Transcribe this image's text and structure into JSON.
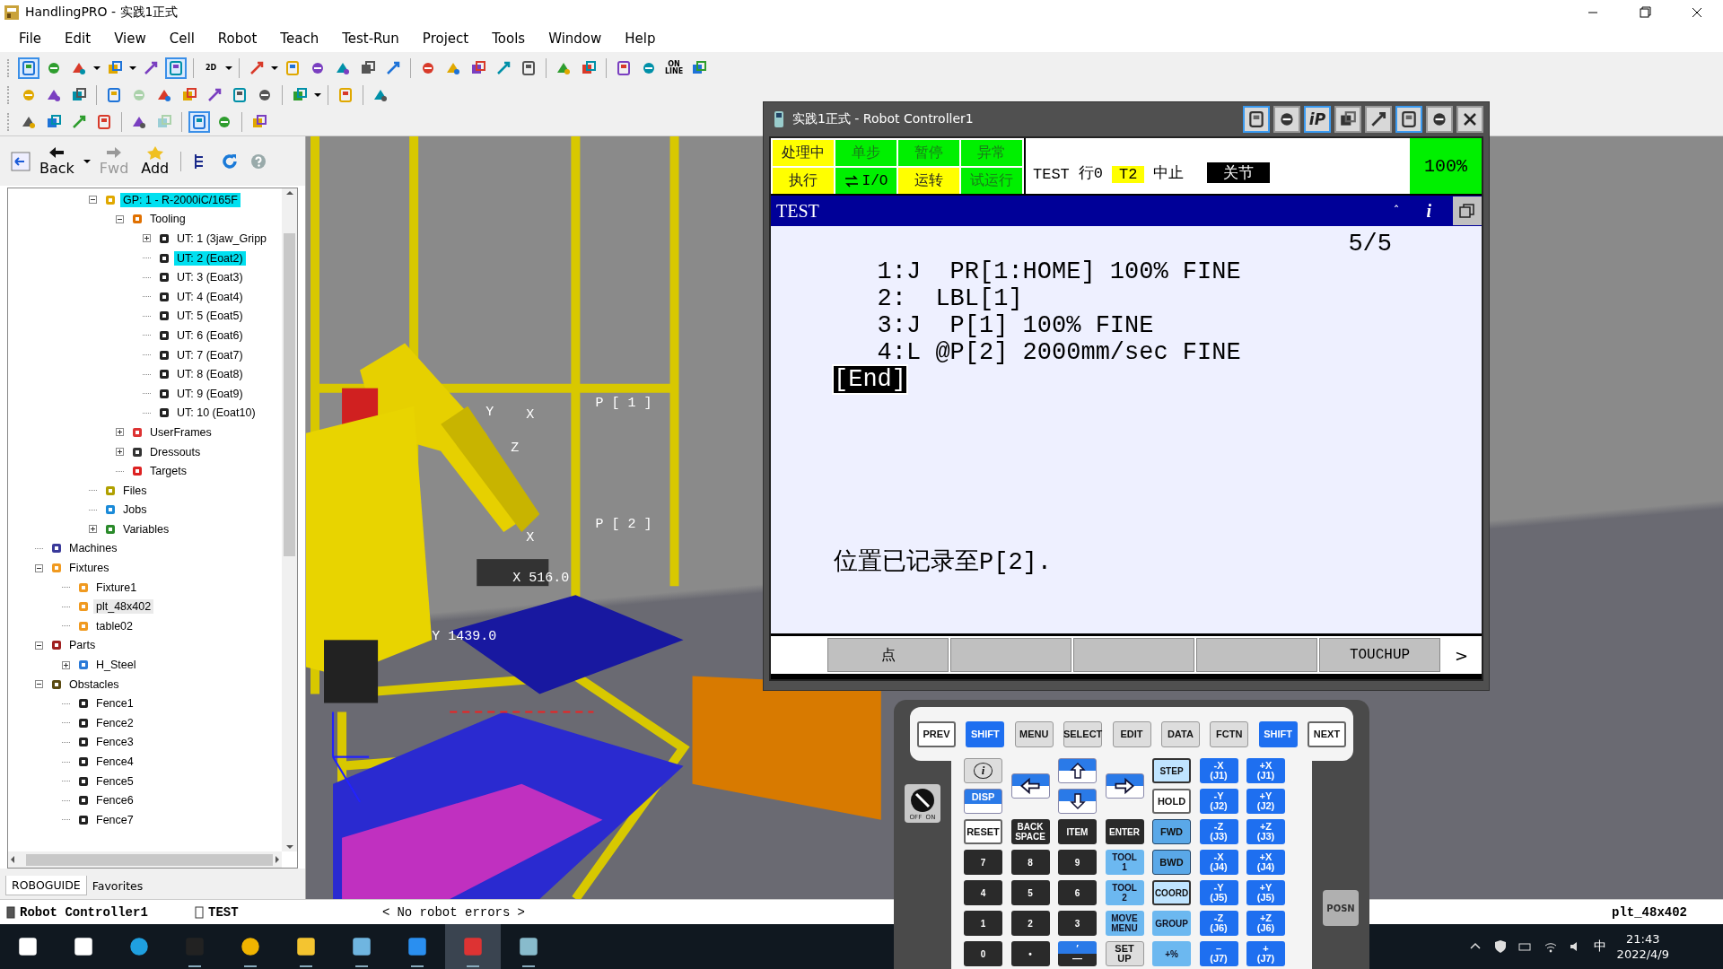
{
  "window": {
    "title": "HandlingPRO - 实践1正式"
  },
  "menu": [
    "File",
    "Edit",
    "View",
    "Cell",
    "Robot",
    "Teach",
    "Test-Run",
    "Project",
    "Tools",
    "Window",
    "Help"
  ],
  "toolbars": [
    [
      {
        "kind": "tool",
        "selected": true
      },
      {
        "kind": "tool",
        "selected": false
      },
      {
        "kind": "tool",
        "selected": false,
        "dropdown": true
      },
      {
        "kind": "tool",
        "selected": false,
        "dropdown": true
      },
      {
        "kind": "tool",
        "selected": false
      },
      {
        "kind": "tool",
        "selected": true
      },
      {
        "kind": "separator"
      },
      {
        "kind": "tool",
        "selected": false,
        "dropdown": true,
        "label": "2D"
      },
      {
        "kind": "separator"
      },
      {
        "kind": "tool",
        "selected": false,
        "dropdown": true
      },
      {
        "kind": "tool",
        "selected": false
      },
      {
        "kind": "tool",
        "selected": false
      },
      {
        "kind": "tool",
        "selected": false
      },
      {
        "kind": "tool",
        "selected": false
      },
      {
        "kind": "tool",
        "selected": false
      },
      {
        "kind": "separator"
      },
      {
        "kind": "tool",
        "selected": false
      },
      {
        "kind": "tool",
        "selected": false
      },
      {
        "kind": "tool",
        "selected": false
      },
      {
        "kind": "tool",
        "selected": false
      },
      {
        "kind": "tool",
        "selected": false
      },
      {
        "kind": "separator"
      },
      {
        "kind": "tool",
        "selected": false
      },
      {
        "kind": "tool",
        "selected": false
      },
      {
        "kind": "separator"
      },
      {
        "kind": "tool",
        "selected": false
      },
      {
        "kind": "tool",
        "selected": false
      },
      {
        "kind": "tool",
        "selected": false,
        "label": "ON\nLINE"
      },
      {
        "kind": "tool",
        "selected": false
      }
    ],
    [
      {
        "kind": "tool",
        "selected": false
      },
      {
        "kind": "tool",
        "selected": false
      },
      {
        "kind": "tool",
        "selected": false
      },
      {
        "kind": "separator"
      },
      {
        "kind": "tool",
        "selected": false
      },
      {
        "kind": "tool",
        "selected": false,
        "disabled": true
      },
      {
        "kind": "tool",
        "selected": false
      },
      {
        "kind": "tool",
        "selected": false
      },
      {
        "kind": "tool",
        "selected": false
      },
      {
        "kind": "tool",
        "selected": false
      },
      {
        "kind": "tool",
        "selected": false
      },
      {
        "kind": "separator"
      },
      {
        "kind": "tool",
        "selected": false,
        "dropdown": true
      },
      {
        "kind": "separator"
      },
      {
        "kind": "tool",
        "selected": false
      },
      {
        "kind": "separator"
      },
      {
        "kind": "tool",
        "selected": false
      }
    ],
    [
      {
        "kind": "tool",
        "selected": false
      },
      {
        "kind": "tool",
        "selected": false
      },
      {
        "kind": "tool",
        "selected": false
      },
      {
        "kind": "tool",
        "selected": false
      },
      {
        "kind": "separator"
      },
      {
        "kind": "tool",
        "selected": false
      },
      {
        "kind": "tool",
        "selected": false,
        "disabled": true
      },
      {
        "kind": "separator"
      },
      {
        "kind": "tool",
        "selected": true
      },
      {
        "kind": "tool",
        "selected": false
      },
      {
        "kind": "separator"
      },
      {
        "kind": "tool",
        "selected": false
      }
    ]
  ],
  "nav": [
    {
      "label": "Back",
      "dropdown": true,
      "disabled": false
    },
    {
      "label": "Fwd",
      "disabled": true
    },
    {
      "label": "Add",
      "disabled": false
    }
  ],
  "tree": {
    "branch": [
      {
        "label": "GP: 1 - R-2000iC/165F",
        "kind": "robot",
        "selected": true,
        "expanded": true,
        "children": [
          {
            "label": "Tooling",
            "kind": "tooling",
            "selected": false,
            "expanded": true,
            "children": [
              {
                "label": "UT: 1  (3jaw_Gripp",
                "kind": "tool",
                "selected": false,
                "expanded": false
              },
              {
                "label": "UT: 2  (Eoat2)",
                "kind": "tool",
                "selected": true
              },
              {
                "label": "UT: 3  (Eoat3)",
                "kind": "tool",
                "selected": false
              },
              {
                "label": "UT: 4  (Eoat4)",
                "kind": "tool",
                "selected": false
              },
              {
                "label": "UT: 5  (Eoat5)",
                "kind": "tool",
                "selected": false
              },
              {
                "label": "UT: 6  (Eoat6)",
                "kind": "tool",
                "selected": false
              },
              {
                "label": "UT: 7  (Eoat7)",
                "kind": "tool",
                "selected": false
              },
              {
                "label": "UT: 8  (Eoat8)",
                "kind": "tool",
                "selected": false
              },
              {
                "label": "UT: 9  (Eoat9)",
                "kind": "tool",
                "selected": false
              },
              {
                "label": "UT: 10  (Eoat10)",
                "kind": "tool",
                "selected": false
              }
            ]
          },
          {
            "label": "UserFrames",
            "kind": "frames",
            "selected": false,
            "expanded": false
          },
          {
            "label": "Dressouts",
            "kind": "dressouts",
            "selected": false,
            "expanded": false
          },
          {
            "label": "Targets",
            "kind": "targets",
            "selected": false
          }
        ]
      },
      {
        "label": "Files",
        "kind": "files",
        "selected": false
      },
      {
        "label": "Jobs",
        "kind": "jobs",
        "selected": false
      },
      {
        "label": "Variables",
        "kind": "variables",
        "selected": false,
        "expanded": false
      }
    ],
    "items": [
      {
        "label": "Machines",
        "kind": "machines",
        "selected": false
      },
      {
        "label": "Fixtures",
        "kind": "fixtures",
        "selected": false,
        "expanded": true,
        "children": [
          {
            "label": "Fixture1",
            "kind": "fixture",
            "selected": false
          },
          {
            "label": "plt_48x402",
            "kind": "fixture",
            "selected": false,
            "hovered": true
          },
          {
            "label": "table02",
            "kind": "fixture",
            "selected": false
          }
        ]
      },
      {
        "label": "Parts",
        "kind": "parts",
        "selected": false,
        "expanded": true,
        "children": [
          {
            "label": "H_Steel",
            "kind": "part",
            "selected": false,
            "expanded": false
          }
        ]
      },
      {
        "label": "Obstacles",
        "kind": "obstacles",
        "selected": false,
        "expanded": true,
        "children": [
          {
            "label": "Fence1",
            "kind": "fence",
            "selected": false
          },
          {
            "label": "Fence2",
            "kind": "fence",
            "selected": false
          },
          {
            "label": "Fence3",
            "kind": "fence",
            "selected": false
          },
          {
            "label": "Fence4",
            "kind": "fence",
            "selected": false
          },
          {
            "label": "Fence5",
            "kind": "fence",
            "selected": false
          },
          {
            "label": "Fence6",
            "kind": "fence",
            "selected": false
          },
          {
            "label": "Fence7",
            "kind": "fence",
            "selected": false
          }
        ]
      }
    ]
  },
  "panel_tabs": [
    {
      "label": "ROBOGUIDE",
      "selected": true
    },
    {
      "label": "Favorites",
      "selected": false
    }
  ],
  "scene": {
    "labels": [
      "P [ 1 ]",
      "P [ 2 ]",
      "X 516.0",
      "Y 1439.0",
      "Y",
      "X",
      "Z",
      "X"
    ]
  },
  "controller": {
    "title": "实践1正式 - Robot Controller1",
    "header_buttons": [
      {
        "selected": true
      },
      {
        "selected": false
      },
      {
        "label": "iP",
        "selected": true
      },
      {
        "selected": false
      },
      {
        "selected": false
      },
      {
        "selected": true
      },
      {
        "selected": false
      }
    ],
    "status_cells": [
      {
        "label": "处理中",
        "on": true
      },
      {
        "label": "单步",
        "on": false
      },
      {
        "label": "暂停",
        "on": false
      },
      {
        "label": "异常",
        "on": false
      },
      {
        "label": "执行",
        "on": true
      },
      {
        "label": "I/O",
        "on": false,
        "kind": "io"
      },
      {
        "label": "运转",
        "on": true
      },
      {
        "label": "试运行",
        "on": false
      }
    ],
    "status_line": [
      {
        "text": "TEST",
        "kind": "plain"
      },
      {
        "text": "行0",
        "kind": "plain"
      },
      {
        "text": "T2",
        "kind": "mode"
      },
      {
        "text": "中止",
        "kind": "plain"
      },
      {
        "text": "关节",
        "kind": "inverse"
      }
    ],
    "override": "100%",
    "program_name": "TEST",
    "scroll_mark": "ˆ",
    "info": "i",
    "line_count": "5/5",
    "lines": [
      {
        "text": "1:J  PR[1:HOME] 100% FINE",
        "kind": "statement",
        "selected": false
      },
      {
        "text": "2:  LBL[1]",
        "kind": "statement",
        "selected": false
      },
      {
        "text": "3:J  P[1] 100% FINE",
        "kind": "statement",
        "selected": false
      },
      {
        "text": "4:L @P[2] 2000mm/sec FINE",
        "kind": "statement",
        "selected": false
      },
      {
        "text": "[End]",
        "kind": "end",
        "selected": true
      }
    ],
    "message": "位置已记录至P[2].",
    "softkeys": {
      "f1": "点",
      "f5": "TOUCHUP"
    },
    "next": ">"
  },
  "keypad": {
    "top": [
      {
        "label": "PREV",
        "kind": "white"
      },
      {
        "label": "SHIFT",
        "kind": "blue"
      },
      {
        "label": "MENU",
        "kind": "gray"
      },
      {
        "label": "SELECT",
        "kind": "gray"
      },
      {
        "label": "EDIT",
        "kind": "gray"
      },
      {
        "label": "DATA",
        "kind": "gray"
      },
      {
        "label": "FCTN",
        "kind": "gray"
      },
      {
        "label": "SHIFT",
        "kind": "blue"
      },
      {
        "label": "NEXT",
        "kind": "white"
      }
    ],
    "keys": [
      {
        "label": "i",
        "kind": "info"
      },
      {
        "kind": "left"
      },
      {
        "kind": "up"
      },
      {
        "kind": "right"
      },
      {
        "label": "STEP",
        "kind": "framed"
      },
      {
        "label": "-X\n(J1)",
        "kind": "blue"
      },
      {
        "label": "+X\n(J1)",
        "kind": "blue"
      },
      {
        "label": "DISP",
        "kind": "disp"
      },
      {
        "kind": "down"
      },
      {
        "label": "HOLD",
        "kind": "white"
      },
      {
        "label": "-Y\n(J2)",
        "kind": "blue"
      },
      {
        "label": "+Y\n(J2)",
        "kind": "blue"
      },
      {
        "label": "RESET",
        "kind": "white"
      },
      {
        "label": "BACK\nSPACE",
        "kind": "dark"
      },
      {
        "label": "ITEM",
        "kind": "dark"
      },
      {
        "label": "ENTER",
        "kind": "dark"
      },
      {
        "label": "FWD",
        "kind": "fwd"
      },
      {
        "label": "-Z\n(J3)",
        "kind": "blue"
      },
      {
        "label": "+Z\n(J3)",
        "kind": "blue"
      },
      {
        "label": "7",
        "kind": "dark"
      },
      {
        "label": "8",
        "kind": "dark"
      },
      {
        "label": "9",
        "kind": "dark"
      },
      {
        "label": "TOOL\n1",
        "kind": "light"
      },
      {
        "label": "BWD",
        "kind": "fwd"
      },
      {
        "label": "-X\n(J4)",
        "kind": "blue"
      },
      {
        "label": "+X\n(J4)",
        "kind": "blue"
      },
      {
        "label": "4",
        "kind": "dark"
      },
      {
        "label": "5",
        "kind": "dark"
      },
      {
        "label": "6",
        "kind": "dark"
      },
      {
        "label": "TOOL\n2",
        "kind": "light"
      },
      {
        "label": "COORD",
        "kind": "framed"
      },
      {
        "label": "-Y\n(J5)",
        "kind": "blue"
      },
      {
        "label": "+Y\n(J5)",
        "kind": "blue"
      },
      {
        "label": "1",
        "kind": "dark"
      },
      {
        "label": "2",
        "kind": "dark"
      },
      {
        "label": "3",
        "kind": "dark"
      },
      {
        "label": "MOVE\nMENU",
        "kind": "light"
      },
      {
        "label": "GROUP",
        "kind": "light"
      },
      {
        "label": "-Z\n(J6)",
        "kind": "blue"
      },
      {
        "label": "+Z\n(J6)",
        "kind": "blue"
      },
      {
        "label": "0",
        "kind": "dark"
      },
      {
        "label": "•",
        "kind": "dark"
      },
      {
        "label": "′\n—",
        "kind": "split"
      },
      {
        "label": "SET\nUP",
        "kind": "gray"
      },
      {
        "label": "+%",
        "kind": "light"
      },
      {
        "label": "–\n(J7)",
        "kind": "blue"
      },
      {
        "label": "+\n(J7)",
        "kind": "blue"
      }
    ],
    "switch": {
      "labels": [
        "OFF",
        "ON"
      ],
      "on": false
    },
    "side": "POSN"
  },
  "status_bar": {
    "items": [
      "Robot Controller1",
      "TEST"
    ],
    "arrows": [
      "<",
      ">"
    ],
    "message": "No robot errors",
    "right": "plt_48x402"
  },
  "taskbar": {
    "apps": [
      {
        "active": false,
        "running": false
      },
      {
        "active": false,
        "running": false
      },
      {
        "active": false,
        "running": false
      },
      {
        "active": false,
        "running": true
      },
      {
        "active": false,
        "running": true
      },
      {
        "active": false,
        "running": true
      },
      {
        "active": false,
        "running": true
      },
      {
        "active": false,
        "running": true
      },
      {
        "active": true,
        "running": true
      },
      {
        "active": false,
        "running": true
      }
    ],
    "ime": "中",
    "time": "21:43",
    "date": "2022/4/9"
  }
}
